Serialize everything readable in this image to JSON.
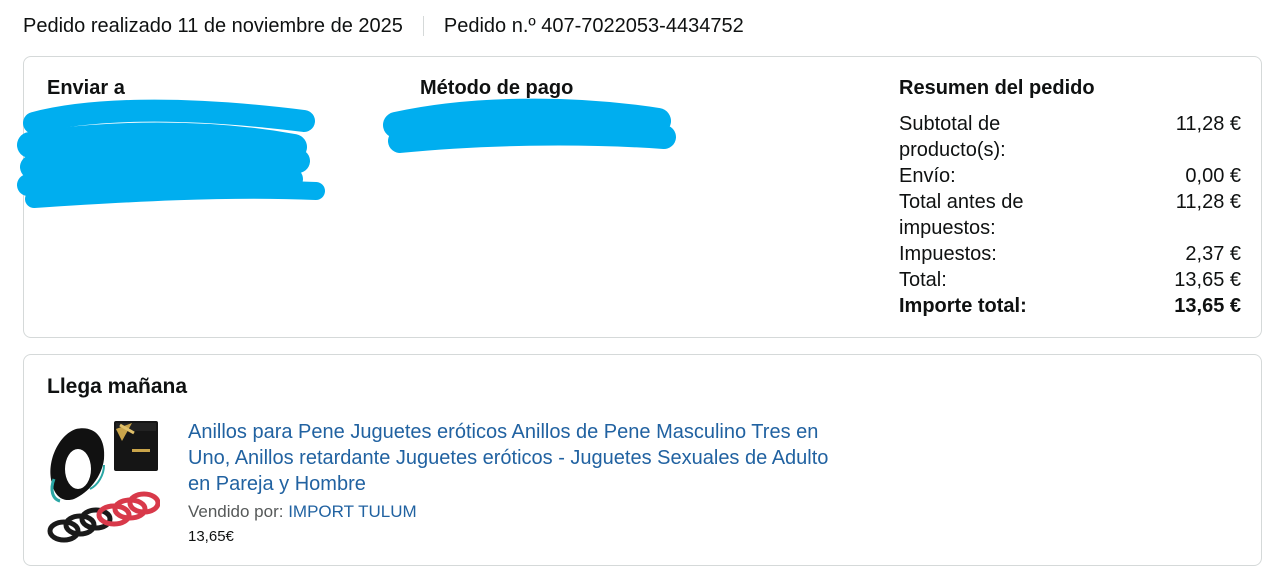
{
  "order": {
    "placed_text": "Pedido realizado 11 de noviembre de 2025",
    "number_text": "Pedido n.º 407-7022053-4434752"
  },
  "shipping": {
    "title": "Enviar a"
  },
  "payment": {
    "title": "Método de pago"
  },
  "summary": {
    "title": "Resumen del pedido",
    "rows": [
      {
        "label": "Subtotal de producto(s):",
        "value": "11,28 €"
      },
      {
        "label": "Envío:",
        "value": "0,00 €"
      },
      {
        "label": "Total antes de impuestos:",
        "value": "11,28 €"
      },
      {
        "label": "Impuestos:",
        "value": "2,37 €"
      },
      {
        "label": "Total:",
        "value": "13,65 €"
      }
    ],
    "grand_total": {
      "label": "Importe total:",
      "value": "13,65 €"
    }
  },
  "delivery": {
    "title": "Llega mañana",
    "item": {
      "title": "Anillos para Pene Juguetes eróticos Anillos de Pene Masculino Tres en Uno, Anillos retardante Juguetes eróticos - Juguetes Sexuales de Adulto en Pareja y Hombre",
      "seller_label": "Vendido por:",
      "seller_name": "IMPORT TULUM",
      "price": "13,65€"
    }
  },
  "colors": {
    "link": "#2162a1",
    "redaction": "#00aeef",
    "border": "#d5d9d9"
  }
}
